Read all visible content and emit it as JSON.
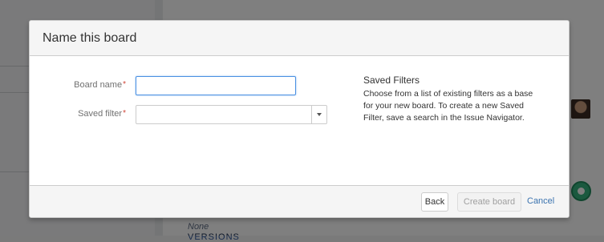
{
  "background": {
    "none_label": "None",
    "sub_label": "VERSIONS"
  },
  "dialog": {
    "title": "Name this board",
    "fields": {
      "board_name": {
        "label": "Board name",
        "required_mark": "*",
        "value": ""
      },
      "saved_filter": {
        "label": "Saved filter",
        "required_mark": "*",
        "value": ""
      }
    },
    "help": {
      "title": "Saved Filters",
      "text": "Choose from a list of existing filters as a base for your new board. To create a new Saved Filter, save a search in the Issue Navigator."
    },
    "footer": {
      "back_label": "Back",
      "create_label": "Create board",
      "cancel_label": "Cancel"
    }
  },
  "icons": {
    "dropdown": "chevron-down-icon",
    "user_avatar": "avatar",
    "assistant": "bot-icon"
  },
  "colors": {
    "required": "#d04437",
    "link": "#3b73af",
    "focus": "#4a90e2"
  }
}
